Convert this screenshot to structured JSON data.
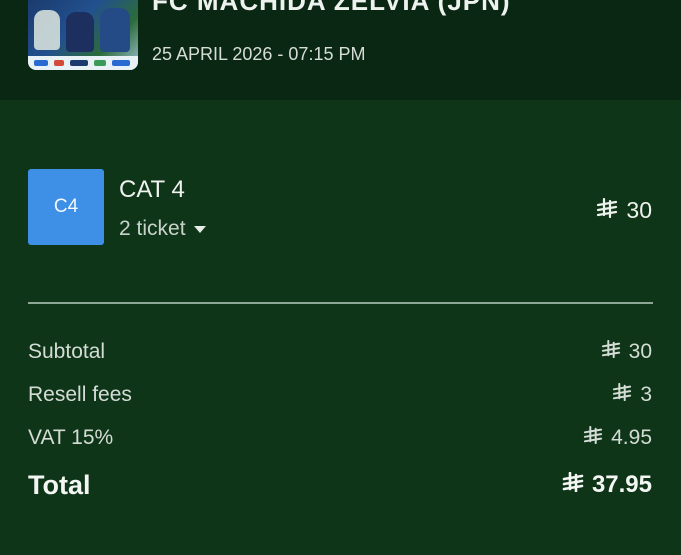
{
  "event": {
    "title": "FC MACHIDA ZELVIA (JPN)",
    "date": "25 APRIL 2026 - 07:15 PM"
  },
  "ticket": {
    "badge": "C4",
    "category": "CAT 4",
    "quantity_label": "2 ticket",
    "price": "30"
  },
  "summary": {
    "subtotal_label": "Subtotal",
    "subtotal_value": "30",
    "fees_label": "Resell fees",
    "fees_value": "3",
    "vat_label": "VAT 15%",
    "vat_value": "4.95",
    "total_label": "Total",
    "total_value": "37.95"
  },
  "colors": {
    "background": "#0f3518",
    "header": "#0a2713",
    "badge": "#3e8fe6",
    "divider": "#8ea695"
  },
  "icons": {
    "currency": "saudi-riyal-icon",
    "dropdown": "caret-down-icon"
  }
}
